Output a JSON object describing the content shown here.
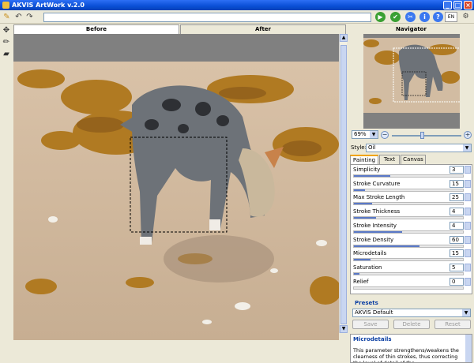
{
  "window": {
    "title": "AKVIS ArtWork v.2.0",
    "controls": [
      "minimize",
      "maximize",
      "close"
    ]
  },
  "toolbar": {
    "tools": [
      "brush-icon",
      "undo-icon",
      "redo-icon"
    ],
    "url_value": "",
    "run_buttons": [
      {
        "name": "run-button",
        "glyph": "▶",
        "color": "#3aa033"
      },
      {
        "name": "apply-button",
        "glyph": "✔",
        "color": "#3aa033"
      },
      {
        "name": "settings-button",
        "glyph": "✂",
        "color": "#3b78f0"
      },
      {
        "name": "info-button",
        "glyph": "i",
        "color": "#3b78f0"
      },
      {
        "name": "help-button",
        "glyph": "?",
        "color": "#3b78f0"
      }
    ],
    "language": "EN"
  },
  "left_tools": [
    "move-icon",
    "pencil-icon",
    "eraser-icon"
  ],
  "view_tabs": [
    {
      "label": "Before",
      "active": true
    },
    {
      "label": "After",
      "active": false
    }
  ],
  "navigator": {
    "title": "Navigator",
    "zoom": "69%"
  },
  "style": {
    "label": "Style:",
    "value": "Oil"
  },
  "param_tabs": [
    {
      "label": "Painting",
      "active": true
    },
    {
      "label": "Text",
      "active": false
    },
    {
      "label": "Canvas",
      "active": false
    }
  ],
  "parameters": [
    {
      "label": "Simplicity",
      "value": "3",
      "fill": 0.33
    },
    {
      "label": "Stroke Curvature",
      "value": "15",
      "fill": 0.1
    },
    {
      "label": "Max Stroke Length",
      "value": "25",
      "fill": 0.17
    },
    {
      "label": "Stroke Thickness",
      "value": "4",
      "fill": 0.2
    },
    {
      "label": "Stroke Intensity",
      "value": "4",
      "fill": 0.44
    },
    {
      "label": "Stroke Density",
      "value": "60",
      "fill": 0.6
    },
    {
      "label": "Microdetails",
      "value": "15",
      "fill": 0.15
    },
    {
      "label": "Saturation",
      "value": "5",
      "fill": 0.05
    },
    {
      "label": "Relief",
      "value": "0",
      "fill": 0.0
    }
  ],
  "presets": {
    "title": "Presets",
    "selected": "AKVIS Default",
    "save": "Save",
    "delete": "Delete",
    "reset": "Reset"
  },
  "help": {
    "title": "Microdetails",
    "text": "This parameter strengthens/weakens the clearness of thin strokes, thus correcting the level of detail of the"
  },
  "colors": {
    "titlebar": "#0a4fd6",
    "accent": "#f2a400",
    "panel": "#ece9d8"
  }
}
